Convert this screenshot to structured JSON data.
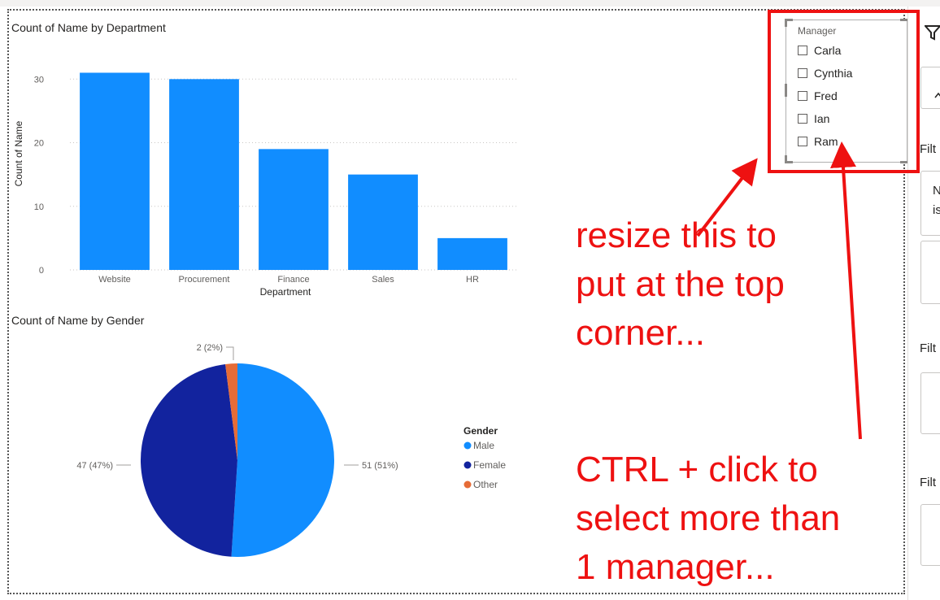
{
  "bar_visual": {
    "title": "Count of Name by Department"
  },
  "pie_visual": {
    "title": "Count of Name by Gender"
  },
  "chart_data": [
    {
      "type": "bar",
      "title": "Count of Name by Department",
      "xlabel": "Department",
      "ylabel": "Count of Name",
      "categories": [
        "Website",
        "Procurement",
        "Finance",
        "Sales",
        "HR"
      ],
      "values": [
        31,
        30,
        19,
        15,
        5
      ],
      "ylim": [
        0,
        34
      ],
      "yticks": [
        0,
        10,
        20,
        30
      ],
      "grid": true,
      "colors": [
        "#118dff"
      ]
    },
    {
      "type": "pie",
      "title": "Count of Name by Gender",
      "legend_title": "Gender",
      "legend_placement": "right",
      "slices": [
        {
          "name": "Male",
          "value": 51,
          "label": "51 (51%)",
          "color": "#118dff"
        },
        {
          "name": "Female",
          "value": 47,
          "label": "47 (47%)",
          "color": "#12239e"
        },
        {
          "name": "Other",
          "value": 2,
          "label": "2 (2%)",
          "color": "#e66c37"
        }
      ]
    }
  ],
  "slicer": {
    "header": "Manager",
    "items": [
      {
        "label": "Carla",
        "checked": false
      },
      {
        "label": "Cynthia",
        "checked": false
      },
      {
        "label": "Fred",
        "checked": false
      },
      {
        "label": "Ian",
        "checked": false
      },
      {
        "label": "Ram",
        "checked": false
      }
    ]
  },
  "filters_pane": {
    "labels": [
      "Filt",
      "Filt",
      "Filt"
    ],
    "card_text": [
      "N",
      "is"
    ]
  },
  "annotations": {
    "resize": [
      "resize this to",
      "put at the top",
      "corner..."
    ],
    "ctrl": [
      "CTRL + click to",
      "select more than",
      "1 manager..."
    ],
    "color": "#ee1111"
  }
}
